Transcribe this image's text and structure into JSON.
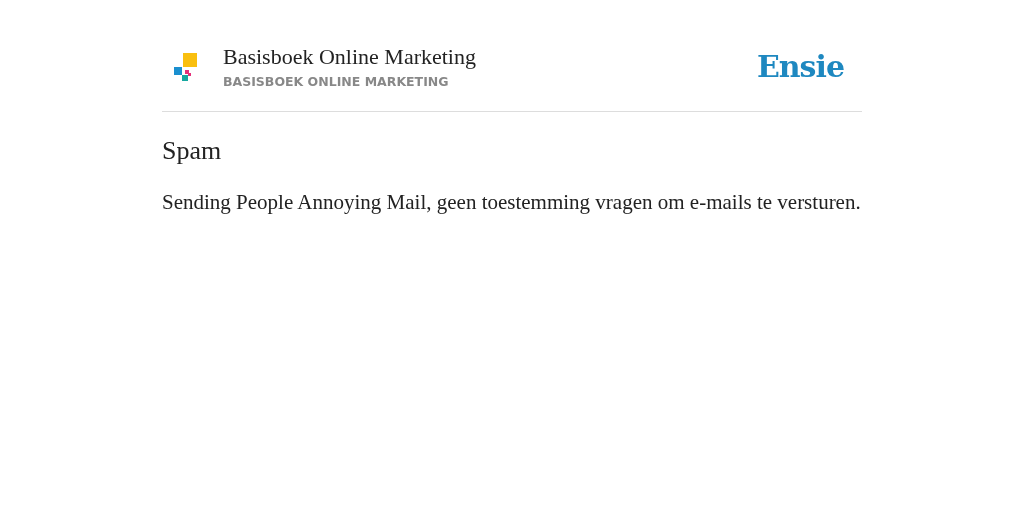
{
  "header": {
    "title": "Basisboek Online Marketing",
    "subtitle": "BASISBOEK ONLINE MARKETING",
    "brand": "Ensie"
  },
  "entry": {
    "term": "Spam",
    "definition": "Sending People Annoying Mail, geen toestemming vragen om e-mails te versturen."
  }
}
